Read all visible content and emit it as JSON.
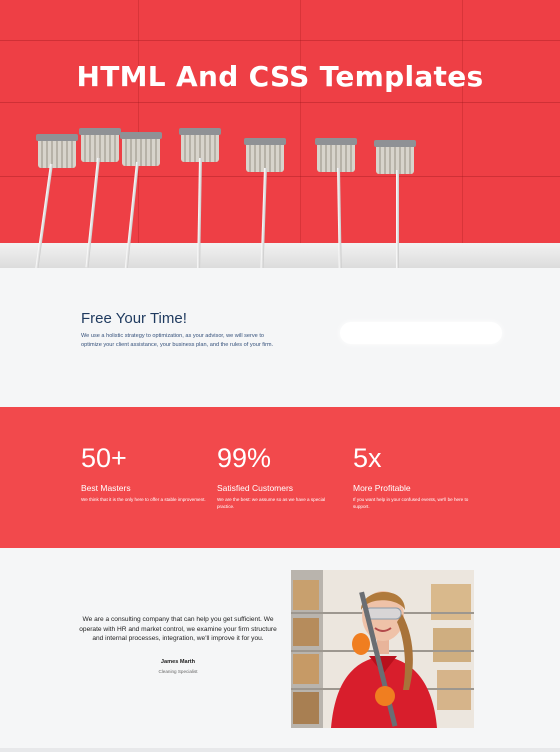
{
  "hero": {
    "title": "HTML And CSS Templates",
    "image": "mops-leaning-on-red-wall",
    "accent": "#ee3f45"
  },
  "intro": {
    "title": "Free Your Time!",
    "text": "We use a holistic strategy to optimization, as your advisor, we will serve to optimize your client assistance, your business plan, and the rules of your firm."
  },
  "stats": {
    "background": "#f2494c",
    "items": [
      {
        "number": "50+",
        "label": "Best Masters",
        "description": "We think that it is the only here to offer a stable improvement."
      },
      {
        "number": "99%",
        "label": "Satisfied Customers",
        "description": "We are the best: we assume so as we have a special practice."
      },
      {
        "number": "5x",
        "label": "More Profitable",
        "description": "If you want help in your confused events, we'll be here to support."
      }
    ]
  },
  "about": {
    "text": "We are a consulting company that can help you get sufficient. We operate with HR and market control, we examine your firm structure and internal processes, integration, we'll improve it for you.",
    "name": "James Marth",
    "role": "Cleaning Specialist",
    "image": "smiling-woman-in-red-jacket-holding-mop"
  }
}
